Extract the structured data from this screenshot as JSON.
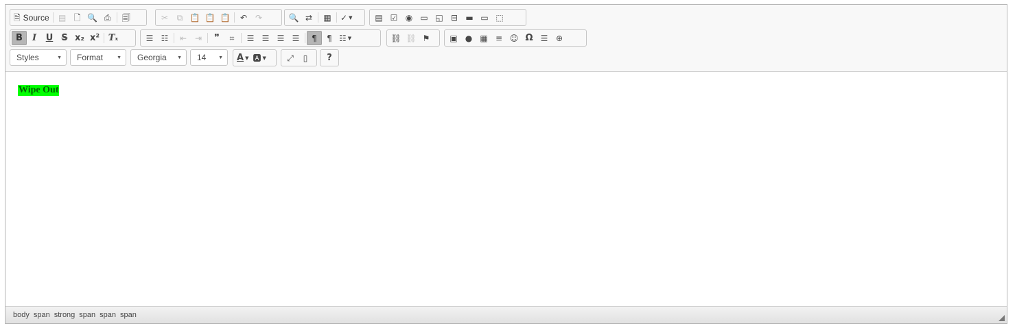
{
  "toolbar": {
    "source_label": "Source",
    "styles": "Styles",
    "format": "Format",
    "font": "Georgia",
    "size": "14",
    "help_label": "?"
  },
  "content": {
    "text": "Wipe Out"
  },
  "statusbar": {
    "path": [
      "body",
      "span",
      "strong",
      "span",
      "span",
      "span"
    ]
  },
  "colors": {
    "highlight": "#00ff00",
    "text": "#006400",
    "toolbar_bg": "#f8f8f8"
  }
}
